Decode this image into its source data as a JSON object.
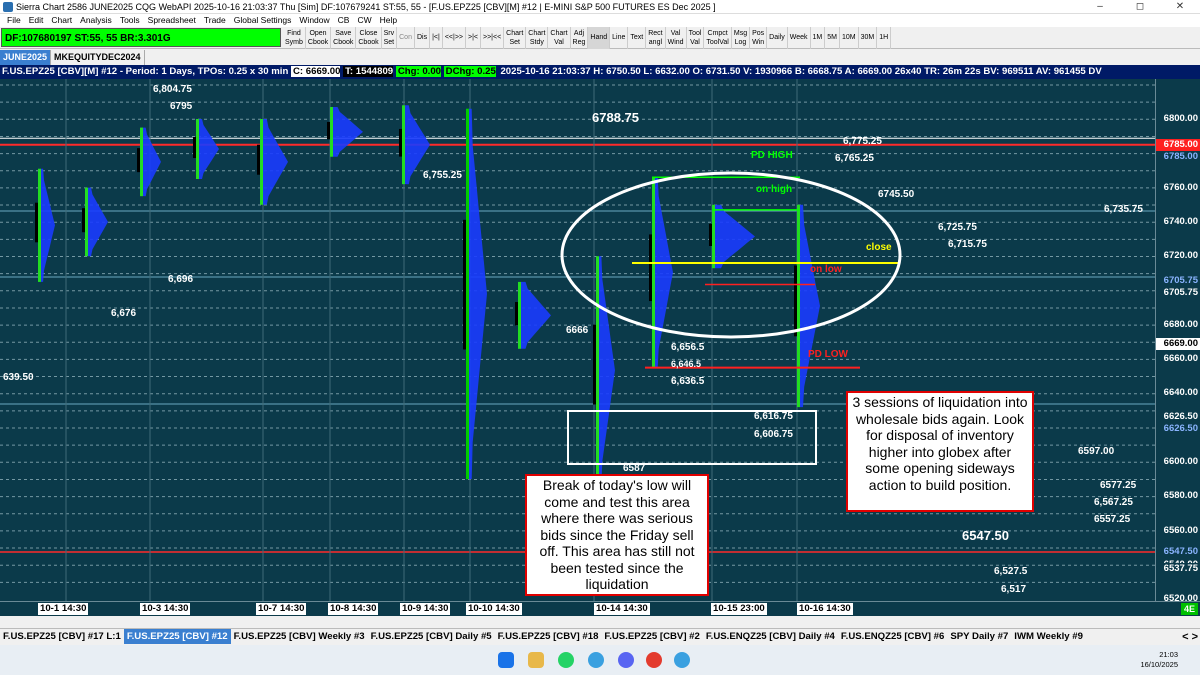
{
  "window": {
    "title": "Sierra Chart 2586 JUNE2025 CQG WebAPI 2025-10-16  21:03:37 Thu [Sim]  DF:107679241  ST:55, 55 - [F.US.EPZ25 [CBV][M] #12 | E-MINI S&P 500 FUTURES ES Dec 2025 ]",
    "minimize": "–",
    "maximize": "◻",
    "close": "✕"
  },
  "menu": [
    "File",
    "Edit",
    "Chart",
    "Analysis",
    "Tools",
    "Spreadsheet",
    "Trade",
    "Global Settings",
    "Window",
    "CB",
    "CW",
    "Help"
  ],
  "toolbar": {
    "status": "DF:107680197  ST:55, 55  BR:3.301G",
    "buttons": [
      {
        "label": "Find\nSymb",
        "state": "normal"
      },
      {
        "label": "Open\nCbook",
        "state": "normal"
      },
      {
        "label": "Save\nCbook",
        "state": "normal"
      },
      {
        "label": "Close\nCbook",
        "state": "normal"
      },
      {
        "label": "Srv\nSet",
        "state": "normal"
      },
      {
        "label": "Con",
        "state": "grey"
      },
      {
        "label": "Dis",
        "state": "normal"
      },
      {
        "label": "|<|",
        "state": "normal"
      },
      {
        "label": "<<|>>",
        "state": "normal"
      },
      {
        "label": ">|<",
        "state": "normal"
      },
      {
        "label": ">>|<<",
        "state": "normal"
      },
      {
        "label": "Chart\nSet",
        "state": "normal"
      },
      {
        "label": "Chart\nStdy",
        "state": "normal"
      },
      {
        "label": "Chart\nVal",
        "state": "normal"
      },
      {
        "label": "Adj\nReg",
        "state": "normal"
      },
      {
        "label": "Hand",
        "state": "pressed"
      },
      {
        "label": "Line",
        "state": "normal"
      },
      {
        "label": "Text",
        "state": "normal"
      },
      {
        "label": "Rect\nangl",
        "state": "normal"
      },
      {
        "label": "Val\nWind",
        "state": "normal"
      },
      {
        "label": "Tool\nVal",
        "state": "normal"
      },
      {
        "label": "Cmpct\nToolVal",
        "state": "normal"
      },
      {
        "label": "Msg\nLog",
        "state": "normal"
      },
      {
        "label": "Pos\nWin",
        "state": "normal"
      },
      {
        "label": "Daily",
        "state": "normal"
      },
      {
        "label": "Week",
        "state": "normal"
      },
      {
        "label": "1M",
        "state": "normal"
      },
      {
        "label": "5M",
        "state": "normal"
      },
      {
        "label": "10M",
        "state": "normal"
      },
      {
        "label": "30M",
        "state": "normal"
      },
      {
        "label": "1H",
        "state": "normal"
      }
    ]
  },
  "chartbooks": [
    {
      "label": "JUNE2025",
      "active": true
    },
    {
      "label": "MKEQUITYDEC2024",
      "active": false
    }
  ],
  "chart_header": {
    "title": "F.US.EPZ25 [CBV][M] #12 - Period: 1 Days, TPOs: 0.25 x 30 min",
    "close": "C: 6669.00",
    "trades": "T: 1544809",
    "chg": "Chg: 0.00",
    "dchg": "DChg: 0.25",
    "stats": "2025-10-16 21:03:37 H: 6750.50 L: 6632.00 O: 6731.50 V: 1930966 B: 6668.75 A: 6669.00 26x40 TR: 26m 22s BV: 969511 AV: 961455 DV"
  },
  "price_axis": {
    "ticks": [
      "6800.00",
      "6780.00",
      "6760.00",
      "6740.00",
      "6720.00",
      "6700.00",
      "6680.00",
      "6660.00",
      "6640.00",
      "6620.00",
      "6600.00",
      "6580.00",
      "6560.00",
      "6540.00",
      "6520.00"
    ],
    "tags": [
      {
        "text": "6785.00",
        "bg": "#ff2020",
        "fg": "#ffffff"
      },
      {
        "text": "6785.00",
        "bg": "#0b3a4a",
        "fg": "#8ab4ff"
      },
      {
        "text": "6705.75",
        "bg": "#0b3a4a",
        "fg": "#8ab4ff"
      },
      {
        "text": "6705.75",
        "bg": "#0b3a4a",
        "fg": "#ffffff"
      },
      {
        "text": "6669.00",
        "bg": "#ffffff",
        "fg": "#000000"
      },
      {
        "text": "6626.50",
        "bg": "#0b3a4a",
        "fg": "#ffffff"
      },
      {
        "text": "6626.50",
        "bg": "#0b3a4a",
        "fg": "#8ab4ff"
      },
      {
        "text": "6547.50",
        "bg": "#0b3a4a",
        "fg": "#8ab4ff"
      },
      {
        "text": "6537.75",
        "bg": "#0b3a4a",
        "fg": "#ffffff"
      }
    ]
  },
  "time_axis": {
    "labels": [
      "10-1  14:30",
      "10-3  14:30",
      "10-7  14:30",
      "10-8  14:30",
      "10-9  14:30",
      "10-10  14:30",
      "10-14  14:30",
      "10-15  23:00",
      "10-16  14:30"
    ],
    "badge": "4E"
  },
  "chart_labels": {
    "p6804": "6,804.75",
    "p6795": "6795",
    "p6755": "6,755.25",
    "p6696": "6,696",
    "p6676": "6,676",
    "p6639": "639.50",
    "p6666": "6666",
    "p6587": "6587",
    "p6788": "6788.75",
    "pd_high": "PD HIGH",
    "on_high": "on high",
    "on_low": "on low",
    "pd_low": "PD LOW",
    "close": "close",
    "p6775": "6,775.25",
    "p6765": "6,765.25",
    "p6745": "6745.50",
    "p6735": "6,735.75",
    "p6725": "6,725.75",
    "p6715": "6,715.75",
    "p6656": "6,656.5",
    "p6646": "6,646.5",
    "p6636": "6,636.5",
    "p6616": "6,616.75",
    "p6606": "6,606.75",
    "p6597": "6597.00",
    "p6577": "6577.25",
    "p6567": "6,567.25",
    "p6557": "6557.25",
    "p6547": "6547.50",
    "p6527": "6,527.5",
    "p6517": "6,517"
  },
  "notes": {
    "left": "Break of today's low will come and test this area where there was serious bids since the Friday sell off.  This area has still not been tested since the liquidation",
    "right": "3 sessions of liquidation into wholesale bids again. Look for disposal of inventory higher into globex after some opening sideways action to build position."
  },
  "chart_tabs": [
    {
      "label": "F.US.EPZ25 [CBV] #17 L:1",
      "active": false
    },
    {
      "label": "F.US.EPZ25 [CBV] #12",
      "active": true
    },
    {
      "label": "F.US.EPZ25 [CBV]  Weekly #3",
      "active": false
    },
    {
      "label": "F.US.EPZ25 [CBV]  Daily #5",
      "active": false
    },
    {
      "label": "F.US.EPZ25 [CBV] #18",
      "active": false
    },
    {
      "label": "F.US.EPZ25 [CBV] #2",
      "active": false
    },
    {
      "label": "F.US.ENQZ25 [CBV]  Daily #4",
      "active": false
    },
    {
      "label": "F.US.ENQZ25 [CBV] #6",
      "active": false
    },
    {
      "label": "SPY  Daily #7",
      "active": false
    },
    {
      "label": "IWM  Weekly #9",
      "active": false
    }
  ],
  "tab_arrows": "< >",
  "taskbar": {
    "time": "21:03",
    "date": "16/10/2025"
  }
}
